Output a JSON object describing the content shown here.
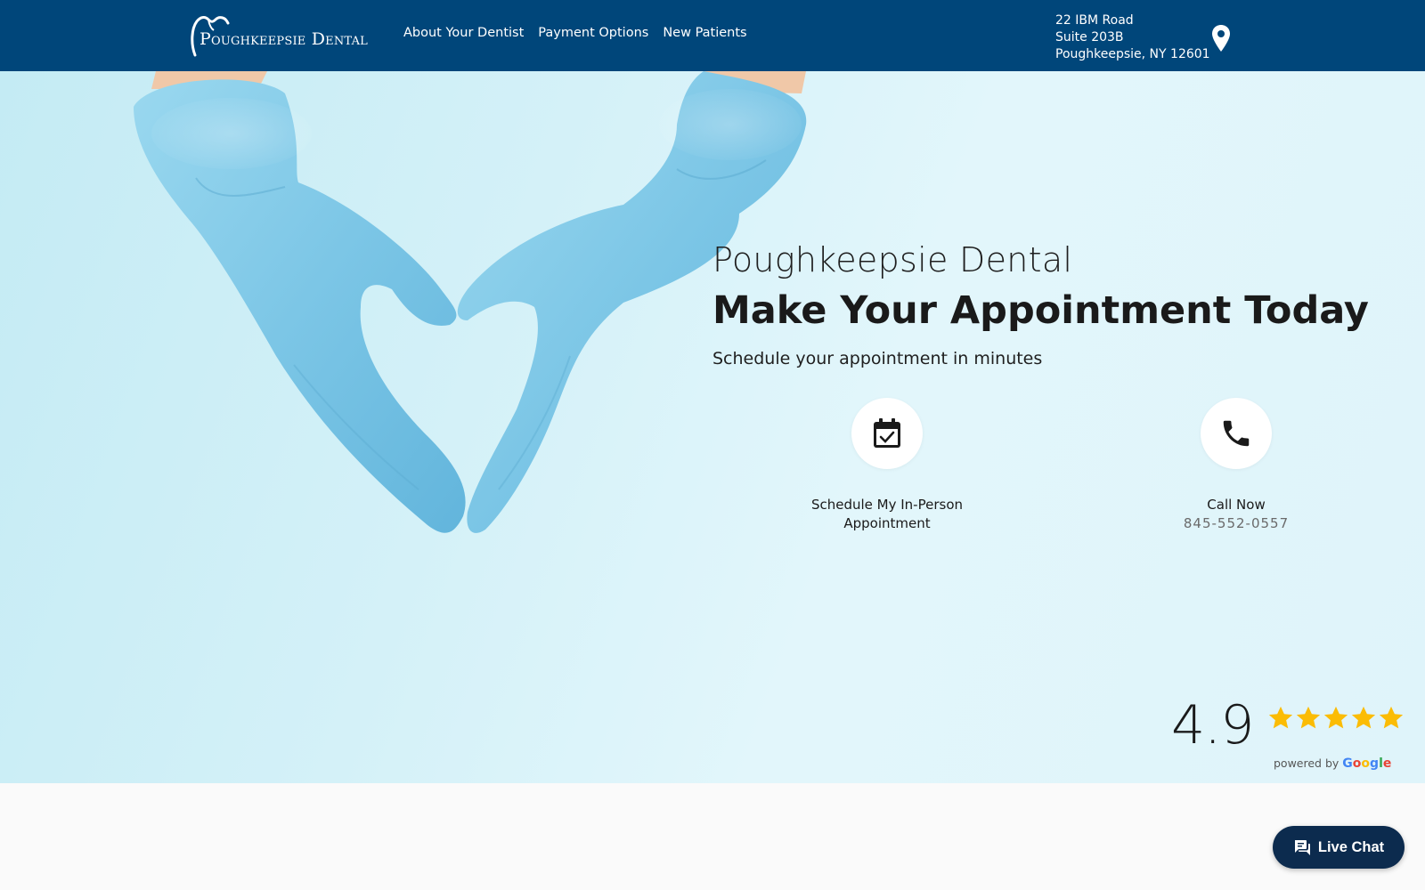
{
  "header": {
    "logo_text": "Poughkeepsie Dental",
    "nav": [
      {
        "label": "About Your Dentist"
      },
      {
        "label": "Payment Options"
      },
      {
        "label": "New Patients"
      }
    ],
    "address": {
      "line1": "22 IBM Road",
      "line2": "Suite 203B",
      "line3": "Poughkeepsie, NY 12601"
    },
    "pin_icon": "map-pin-icon"
  },
  "hero": {
    "subtitle": "Poughkeepsie Dental",
    "title": "Make Your Appointment Today",
    "tagline": "Schedule your appointment in minutes",
    "schedule": {
      "icon": "calendar-check-icon",
      "label_line1": "Schedule My In-Person",
      "label_line2": "Appointment"
    },
    "call": {
      "icon": "phone-icon",
      "label": "Call Now",
      "phone": "845-552-0557"
    }
  },
  "rating": {
    "value": "4.9",
    "stars": 5,
    "max_stars": 5,
    "star_color": "#fbbc05",
    "powered_by": "powered by",
    "google_letters": [
      "G",
      "o",
      "o",
      "g",
      "l",
      "e"
    ]
  },
  "chat": {
    "label": "Live Chat",
    "icon": "chat-bubble-icon"
  },
  "colors": {
    "header_bg": "#00467a",
    "hero_bg": "#d8f3f9",
    "glove": "#7fc8e6",
    "chat_bg": "#0c2b4e"
  }
}
